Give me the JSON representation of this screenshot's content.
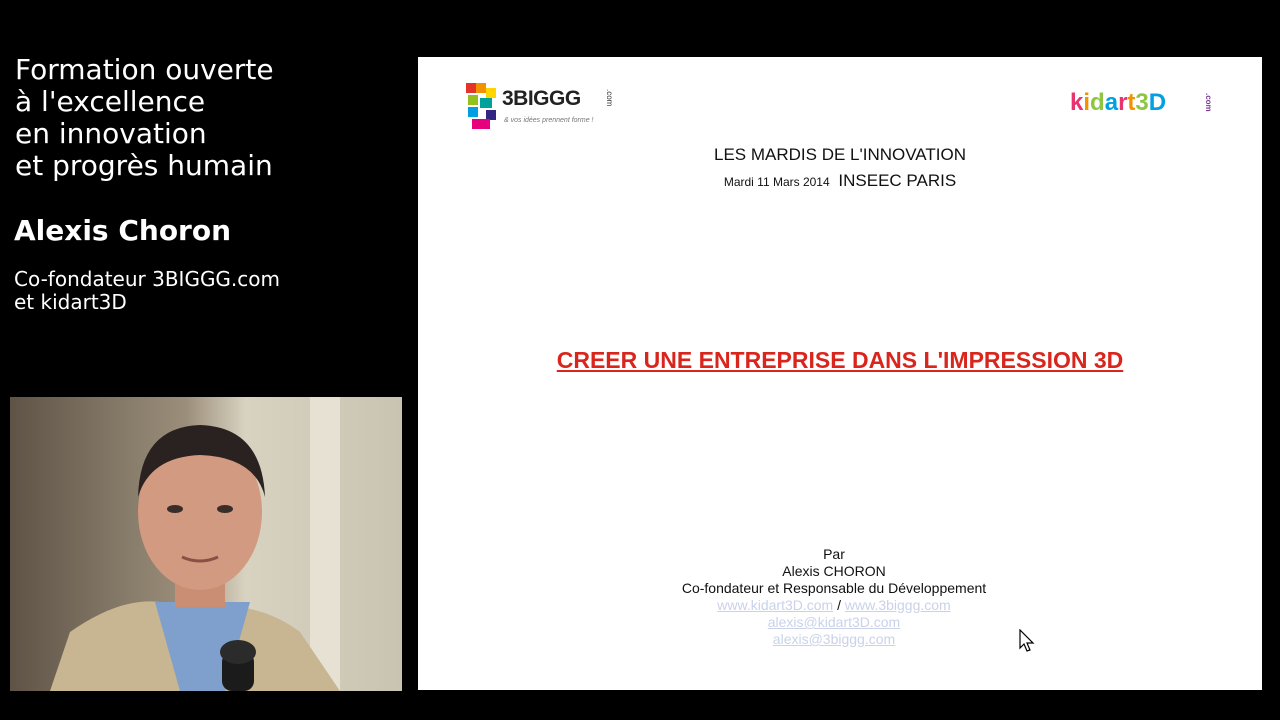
{
  "sidebar": {
    "title_lines": [
      "Formation ouverte",
      "à l'excellence",
      "en innovation",
      "et progrès humain"
    ],
    "speaker_name": "Alexis Choron",
    "speaker_role_lines": [
      "Co-fondateur 3BIGGG.com",
      "et kidart3D"
    ]
  },
  "slide": {
    "logo_left": {
      "brand": "3BIGGG",
      "com": ".com",
      "tagline": "& vos idées prennent forme !"
    },
    "logo_right": {
      "letters": [
        "k",
        "i",
        "d",
        "a",
        "r",
        "t",
        "3",
        "D"
      ],
      "com": ".com"
    },
    "event_title": "LES MARDIS DE L'INNOVATION",
    "event_date": "Mardi  11 Mars  2014",
    "event_place": "INSEEC PARIS",
    "main_title": "CREER UNE ENTREPRISE DANS L'IMPRESSION 3D",
    "author": {
      "by": "Par",
      "name": "Alexis CHORON",
      "role": "Co-fondateur et Responsable du Développement",
      "website1": "www.kidart3D.com",
      "separator": "/",
      "website2": "www.3biggg.com",
      "email1": "alexis@kidart3D.com",
      "email2": "alexis@3biggg.com"
    }
  },
  "colors": {
    "title_red": "#d9251c",
    "kidart_letters": [
      "#e8336d",
      "#f39200",
      "#8dc63f",
      "#00a0e3",
      "#e8336d",
      "#f39200",
      "#8dc63f",
      "#00a0e3"
    ]
  }
}
